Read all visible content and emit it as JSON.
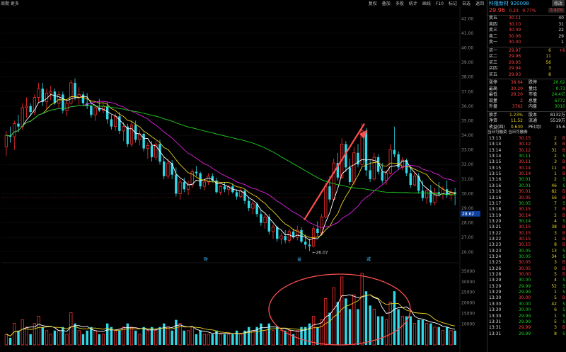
{
  "topbar": {
    "left": "周期 更多",
    "right_items": [
      "复权",
      "叠加",
      "多股",
      "统计",
      "画线",
      "F10",
      "标记",
      "自选",
      "返回"
    ]
  },
  "panel": {
    "stock_name": "科隆新材",
    "stock_code": "920098",
    "fav_button": "修改",
    "price": "29.96",
    "change": "0.23",
    "change_pct": "0.77%",
    "pct_box": "0.42%",
    "asks": [
      {
        "label": "卖五",
        "price": "30.11",
        "vol": "40"
      },
      {
        "label": "卖四",
        "price": "30.10",
        "vol": "31"
      },
      {
        "label": "卖三",
        "price": "30.09",
        "vol": "22"
      },
      {
        "label": "卖二",
        "price": "30.06",
        "vol": "29"
      },
      {
        "label": "卖一",
        "price": "30.00",
        "vol": "1"
      }
    ],
    "bids": [
      {
        "label": "买一",
        "price": "29.97",
        "vol": "6",
        "extra": "+6"
      },
      {
        "label": "买二",
        "price": "29.96",
        "vol": "11",
        "extra": ""
      },
      {
        "label": "买三",
        "price": "29.95",
        "vol": "56",
        "extra": ""
      },
      {
        "label": "买四",
        "price": "29.94",
        "vol": "3",
        "extra": ""
      },
      {
        "label": "买五",
        "price": "29.93",
        "vol": "8",
        "extra": ""
      }
    ],
    "stats": [
      {
        "l1": "涨停",
        "v1": "38.64",
        "l2": "跌停",
        "v2": "20.62"
      },
      {
        "l1": "最高",
        "v1": "30.20",
        "l2": "量比",
        "v2": "0.73"
      },
      {
        "l1": "最低",
        "v1": "29.20",
        "l2": "市值",
        "v2": "24.4亿"
      },
      {
        "l1": "现量",
        "v1": "2",
        "l2": "总量",
        "v2": "6772"
      },
      {
        "l1": "外盘",
        "v1": "3762",
        "l2": "内盘",
        "v2": "3010"
      }
    ],
    "stats2": [
      {
        "l1": "换手",
        "v1": "1.23%",
        "l2": "股本",
        "v2": "8132万"
      },
      {
        "l1": "净资",
        "v1": "11.52",
        "l2": "流通",
        "v2": "5519万"
      },
      {
        "l1": "收益(四)",
        "v1": "0.630",
        "l2": "PE(动)",
        "v2": "35.6"
      }
    ],
    "tabs": "当日可融资 当日可融券",
    "trades": [
      [
        "13:13",
        "30.15",
        "2",
        "B"
      ],
      [
        "13:14",
        "30.12",
        "3",
        "B"
      ],
      [
        "13:14",
        "30.12",
        "31",
        "B"
      ],
      [
        "13:14",
        "30.11",
        "2",
        "S"
      ],
      [
        "13:15",
        "30.11",
        "3",
        "B"
      ],
      [
        "13:15",
        "30.14",
        "11",
        "B"
      ],
      [
        "13:15",
        "30.14",
        "1",
        "B"
      ],
      [
        "13:16",
        "30.01",
        "2",
        "S"
      ],
      [
        "13:16",
        "30.01",
        "46",
        "S"
      ],
      [
        "13:16",
        "30.01",
        "82",
        "B"
      ],
      [
        "13:16",
        "30.05",
        "56",
        "B"
      ],
      [
        "13:17",
        "30.05",
        "7",
        "S"
      ],
      [
        "13:18",
        "30.15",
        "7",
        "B"
      ],
      [
        "13:19",
        "30.14",
        "2",
        "B"
      ],
      [
        "13:20",
        "30.14",
        "4",
        "S"
      ],
      [
        "13:21",
        "30.15",
        "38",
        "B"
      ],
      [
        "13:22",
        "30.15",
        "3",
        "B"
      ],
      [
        "13:22",
        "30.15",
        "1",
        "B"
      ],
      [
        "13:23",
        "30.15",
        "8",
        "B"
      ],
      [
        "13:23",
        "30.05",
        "13",
        "S"
      ],
      [
        "13:24",
        "30.05",
        "34",
        "S"
      ],
      [
        "13:25",
        "30.05",
        "3",
        "B"
      ],
      [
        "13:26",
        "30.05",
        "0",
        "B"
      ],
      [
        "13:28",
        "30.00",
        "5",
        "B"
      ],
      [
        "13:29",
        "30.00",
        "4",
        "S"
      ],
      [
        "13:29",
        "29.99",
        "52",
        "S"
      ],
      [
        "13:29",
        "29.99",
        "1",
        "S"
      ],
      [
        "13:30",
        "30.00",
        "5",
        "B"
      ],
      [
        "13:30",
        "30.00",
        "42",
        "S"
      ],
      [
        "13:30",
        "30.00",
        "6",
        "S"
      ],
      [
        "13:30",
        "29.99",
        "1",
        "S"
      ],
      [
        "13:31",
        "29.99",
        "5",
        "S"
      ],
      [
        "13:31",
        "29.99",
        "3",
        "B"
      ],
      [
        "13:31",
        "29.99",
        "8",
        "S"
      ]
    ]
  },
  "chart_data": {
    "type": "candlestick",
    "price_axis": [
      "42.00",
      "41.00",
      "40.00",
      "39.00",
      "38.00",
      "37.00",
      "36.00",
      "35.00",
      "34.00",
      "33.00",
      "32.00",
      "31.00",
      "30.00",
      "29.00",
      "28.00",
      "27.00",
      "26.00"
    ],
    "ylim": [
      25.6,
      42.6
    ],
    "vol_axis": [
      "35000",
      "30000",
      "25000",
      "20000",
      "15000",
      "10000"
    ],
    "vol_ylim": [
      0,
      37000
    ],
    "low_label": "26.07",
    "last_label": "28.62",
    "markers": [
      "财",
      "益",
      "减"
    ],
    "candles": [
      [
        33.2,
        34.3,
        32.6,
        34.0,
        3
      ],
      [
        34.0,
        34.6,
        33.5,
        33.9,
        2
      ],
      [
        33.9,
        35.0,
        33.0,
        34.8,
        6
      ],
      [
        34.8,
        35.4,
        34.2,
        34.6,
        4
      ],
      [
        34.6,
        36.2,
        34.4,
        35.9,
        7
      ],
      [
        35.9,
        36.6,
        35.2,
        36.0,
        5
      ],
      [
        36.0,
        36.2,
        35.3,
        35.6,
        3
      ],
      [
        35.6,
        36.8,
        35.4,
        36.6,
        6
      ],
      [
        36.6,
        37.6,
        36.3,
        37.2,
        8
      ],
      [
        37.2,
        37.6,
        36.0,
        36.3,
        5
      ],
      [
        36.3,
        37.2,
        35.8,
        36.9,
        4
      ],
      [
        36.9,
        37.4,
        36.4,
        37.0,
        3
      ],
      [
        37.0,
        37.2,
        36.1,
        36.2,
        4
      ],
      [
        36.2,
        37.0,
        35.9,
        36.8,
        4
      ],
      [
        36.8,
        37.0,
        35.5,
        35.7,
        5
      ],
      [
        35.7,
        36.4,
        35.3,
        36.2,
        3
      ],
      [
        36.2,
        37.8,
        36.1,
        37.6,
        9
      ],
      [
        37.6,
        37.9,
        36.4,
        36.6,
        6
      ],
      [
        36.6,
        37.3,
        36.1,
        36.8,
        4
      ],
      [
        36.8,
        37.0,
        36.0,
        36.2,
        3
      ],
      [
        36.2,
        36.9,
        35.8,
        36.0,
        4
      ],
      [
        36.0,
        36.3,
        35.2,
        35.4,
        5
      ],
      [
        35.4,
        36.0,
        35.0,
        35.9,
        4
      ],
      [
        35.9,
        36.5,
        35.6,
        35.7,
        3
      ],
      [
        35.7,
        36.2,
        35.5,
        36.0,
        3
      ],
      [
        36.0,
        36.3,
        34.8,
        35.1,
        6
      ],
      [
        35.1,
        35.4,
        34.4,
        34.6,
        5
      ],
      [
        34.6,
        35.5,
        34.3,
        35.3,
        4
      ],
      [
        35.3,
        35.6,
        34.1,
        34.3,
        4
      ],
      [
        34.3,
        34.9,
        33.6,
        34.6,
        5
      ],
      [
        34.6,
        34.8,
        33.2,
        33.4,
        6
      ],
      [
        33.4,
        35.0,
        33.2,
        34.7,
        5
      ],
      [
        34.7,
        35.0,
        33.5,
        33.7,
        4
      ],
      [
        33.7,
        34.4,
        33.3,
        34.1,
        3
      ],
      [
        34.1,
        34.2,
        32.9,
        33.1,
        5
      ],
      [
        33.1,
        33.5,
        32.4,
        33.3,
        4
      ],
      [
        33.3,
        33.6,
        32.2,
        32.5,
        5
      ],
      [
        32.5,
        33.6,
        32.3,
        33.4,
        4
      ],
      [
        33.4,
        33.7,
        32.0,
        32.2,
        5
      ],
      [
        32.2,
        32.5,
        31.0,
        31.2,
        6
      ],
      [
        31.2,
        32.4,
        31.0,
        32.1,
        5
      ],
      [
        32.1,
        32.3,
        31.0,
        31.3,
        4
      ],
      [
        31.3,
        31.8,
        29.8,
        30.0,
        7
      ],
      [
        30.0,
        31.0,
        29.6,
        30.8,
        6
      ],
      [
        30.8,
        31.1,
        30.1,
        30.3,
        4
      ],
      [
        30.3,
        30.9,
        29.9,
        30.6,
        4
      ],
      [
        30.6,
        31.7,
        30.4,
        31.5,
        5
      ],
      [
        31.5,
        31.9,
        31.2,
        31.4,
        3
      ],
      [
        31.4,
        31.5,
        30.3,
        30.5,
        4
      ],
      [
        30.5,
        31.0,
        30.2,
        30.8,
        3
      ],
      [
        30.8,
        31.4,
        30.6,
        31.2,
        3
      ],
      [
        31.2,
        31.4,
        30.8,
        30.9,
        3
      ],
      [
        30.9,
        31.1,
        30.0,
        30.1,
        4
      ],
      [
        30.1,
        30.6,
        29.9,
        30.5,
        3
      ],
      [
        30.5,
        30.8,
        30.1,
        30.3,
        3
      ],
      [
        30.3,
        30.6,
        29.9,
        30.5,
        3
      ],
      [
        30.5,
        30.7,
        30.0,
        30.1,
        3
      ],
      [
        30.1,
        30.3,
        29.6,
        29.8,
        4
      ],
      [
        29.8,
        30.4,
        29.7,
        30.2,
        3
      ],
      [
        30.2,
        30.3,
        29.3,
        29.5,
        4
      ],
      [
        29.5,
        29.8,
        28.8,
        29.0,
        5
      ],
      [
        29.0,
        29.5,
        28.6,
        29.3,
        4
      ],
      [
        29.3,
        29.4,
        28.4,
        28.6,
        5
      ],
      [
        28.6,
        28.9,
        27.8,
        28.0,
        6
      ],
      [
        28.0,
        28.6,
        27.6,
        28.4,
        4
      ],
      [
        28.4,
        28.6,
        27.2,
        27.4,
        6
      ],
      [
        27.4,
        27.9,
        26.9,
        27.7,
        4
      ],
      [
        27.7,
        27.8,
        26.7,
        26.9,
        5
      ],
      [
        26.9,
        27.3,
        26.5,
        27.1,
        4
      ],
      [
        27.1,
        27.5,
        26.6,
        26.8,
        4
      ],
      [
        26.8,
        27.6,
        26.6,
        27.4,
        4
      ],
      [
        27.4,
        27.6,
        26.9,
        27.0,
        3
      ],
      [
        27.0,
        27.8,
        26.8,
        27.5,
        4
      ],
      [
        27.5,
        27.7,
        26.6,
        26.7,
        5
      ],
      [
        26.7,
        27.2,
        26.2,
        26.5,
        5
      ],
      [
        26.5,
        26.9,
        26.07,
        26.4,
        6
      ],
      [
        26.4,
        27.8,
        26.3,
        27.6,
        8
      ],
      [
        27.6,
        28.1,
        27.1,
        27.3,
        5
      ],
      [
        27.3,
        28.6,
        27.2,
        28.4,
        7
      ],
      [
        28.4,
        30.7,
        28.3,
        30.5,
        13
      ],
      [
        30.5,
        31.2,
        29.4,
        29.6,
        9
      ],
      [
        29.6,
        32.4,
        29.5,
        32.1,
        16
      ],
      [
        32.1,
        32.8,
        30.9,
        31.1,
        12
      ],
      [
        31.1,
        33.8,
        31.0,
        33.4,
        19
      ],
      [
        33.4,
        33.6,
        31.5,
        31.8,
        13
      ],
      [
        31.8,
        32.4,
        30.6,
        30.8,
        10
      ],
      [
        30.8,
        33.2,
        30.6,
        32.8,
        14
      ],
      [
        32.8,
        33.4,
        31.8,
        32.0,
        10
      ],
      [
        32.0,
        34.8,
        31.9,
        34.3,
        20
      ],
      [
        34.3,
        34.5,
        31.2,
        31.6,
        15
      ],
      [
        31.6,
        32.3,
        30.8,
        31.0,
        11
      ],
      [
        31.0,
        32.8,
        30.9,
        32.5,
        10
      ],
      [
        32.5,
        32.7,
        31.3,
        31.5,
        8
      ],
      [
        31.5,
        32.1,
        30.7,
        30.9,
        8
      ],
      [
        30.9,
        31.6,
        30.6,
        31.4,
        7
      ],
      [
        31.4,
        33.4,
        31.3,
        33.0,
        12
      ],
      [
        33.0,
        34.6,
        32.5,
        32.7,
        15
      ],
      [
        32.7,
        32.9,
        31.6,
        31.8,
        10
      ],
      [
        31.8,
        32.5,
        31.6,
        32.3,
        8
      ],
      [
        32.3,
        32.4,
        31.2,
        31.4,
        8
      ],
      [
        31.4,
        31.9,
        30.4,
        30.6,
        8
      ],
      [
        30.6,
        31.5,
        30.5,
        31.2,
        6
      ],
      [
        31.2,
        31.4,
        30.0,
        30.2,
        7
      ],
      [
        30.2,
        30.9,
        29.5,
        29.7,
        7
      ],
      [
        29.7,
        30.4,
        29.3,
        30.2,
        6
      ],
      [
        30.2,
        30.6,
        29.2,
        29.4,
        6
      ],
      [
        29.4,
        30.4,
        29.2,
        30.1,
        5
      ],
      [
        30.1,
        30.8,
        29.8,
        30.0,
        5
      ],
      [
        30.0,
        30.5,
        29.6,
        30.3,
        4
      ],
      [
        30.3,
        30.9,
        29.7,
        29.9,
        5
      ],
      [
        29.9,
        30.3,
        29.5,
        30.1,
        4
      ],
      [
        30.1,
        30.4,
        29.2,
        29.96,
        4
      ]
    ]
  }
}
